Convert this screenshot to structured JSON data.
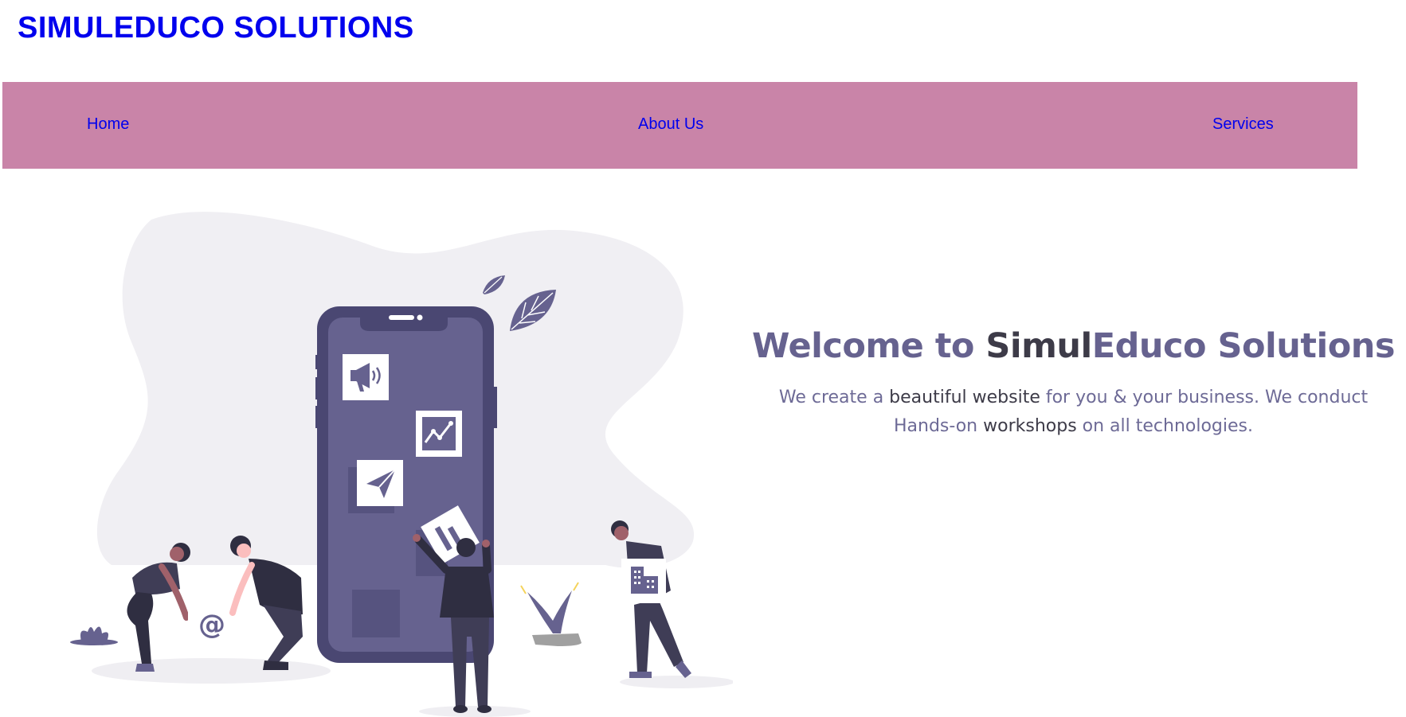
{
  "site": {
    "title": "SIMULEDUCO SOLUTIONS"
  },
  "nav": {
    "items": [
      {
        "label": "Home"
      },
      {
        "label": "About Us"
      },
      {
        "label": "Services"
      }
    ]
  },
  "hero": {
    "heading": {
      "part1": "Welcome to ",
      "part2": "Simul",
      "part3": "Educo Solutions"
    },
    "line1": {
      "part1": "We create a ",
      "part2": "beautiful website",
      "part3": " for you & your business. We conduct"
    },
    "line2": {
      "part1": "Hands-on ",
      "part2": "workshops",
      "part3": " on all technologies."
    },
    "illustration": {
      "at_symbol": "@",
      "icons": [
        "megaphone-icon",
        "chart-icon",
        "paper-plane-icon",
        "building-icon",
        "leaf-icon"
      ]
    }
  },
  "colors": {
    "title": "#0000ee",
    "navbar": "#c984a8",
    "accent": "#66628f",
    "dark_text": "#3d3b48",
    "blob": "#f0eff3"
  }
}
